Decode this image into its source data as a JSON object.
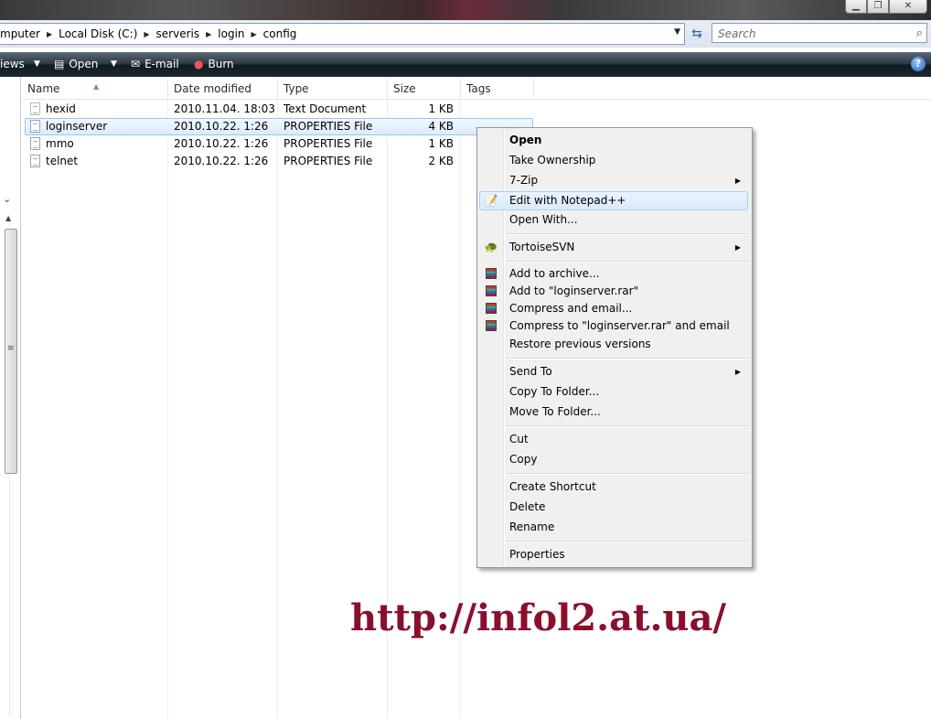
{
  "address_bar": {
    "crumbs": [
      "mputer",
      "Local Disk (C:)",
      "serveris",
      "login",
      "config"
    ],
    "search_placeholder": "Search"
  },
  "toolbar": {
    "views_label": "iews",
    "open_label": "Open",
    "email_label": "E-mail",
    "burn_label": "Burn",
    "help_label": "?"
  },
  "file_list": {
    "columns": [
      "Name",
      "Date modified",
      "Type",
      "Size",
      "Tags"
    ],
    "rows": [
      {
        "name": "hexid",
        "date": "2010.11.04. 18:03",
        "type": "Text Document",
        "size": "1 KB"
      },
      {
        "name": "loginserver",
        "date": "2010.10.22. 1:26",
        "type": "PROPERTIES File",
        "size": "4 KB"
      },
      {
        "name": "mmo",
        "date": "2010.10.22. 1:26",
        "type": "PROPERTIES File",
        "size": "1 KB"
      },
      {
        "name": "telnet",
        "date": "2010.10.22. 1:26",
        "type": "PROPERTIES File",
        "size": "2 KB"
      }
    ],
    "selected_row": "loginserver"
  },
  "context_menu": {
    "items": [
      {
        "label": "Open"
      },
      {
        "label": "Take Ownership"
      },
      {
        "label": "7-Zip"
      },
      {
        "label": "Edit with Notepad++"
      },
      {
        "label": "Open With..."
      },
      {
        "label": "TortoiseSVN"
      },
      {
        "label": "Add to archive..."
      },
      {
        "label": "Add to \"loginserver.rar\""
      },
      {
        "label": "Compress and email..."
      },
      {
        "label": "Compress to \"loginserver.rar\" and email"
      },
      {
        "label": "Restore previous versions"
      },
      {
        "label": "Send To"
      },
      {
        "label": "Copy To Folder..."
      },
      {
        "label": "Move To Folder..."
      },
      {
        "label": "Cut"
      },
      {
        "label": "Copy"
      },
      {
        "label": "Create Shortcut"
      },
      {
        "label": "Delete"
      },
      {
        "label": "Rename"
      },
      {
        "label": "Properties"
      }
    ],
    "highlighted": "Edit with Notepad++"
  },
  "watermark": "http://infol2.at.ua/"
}
